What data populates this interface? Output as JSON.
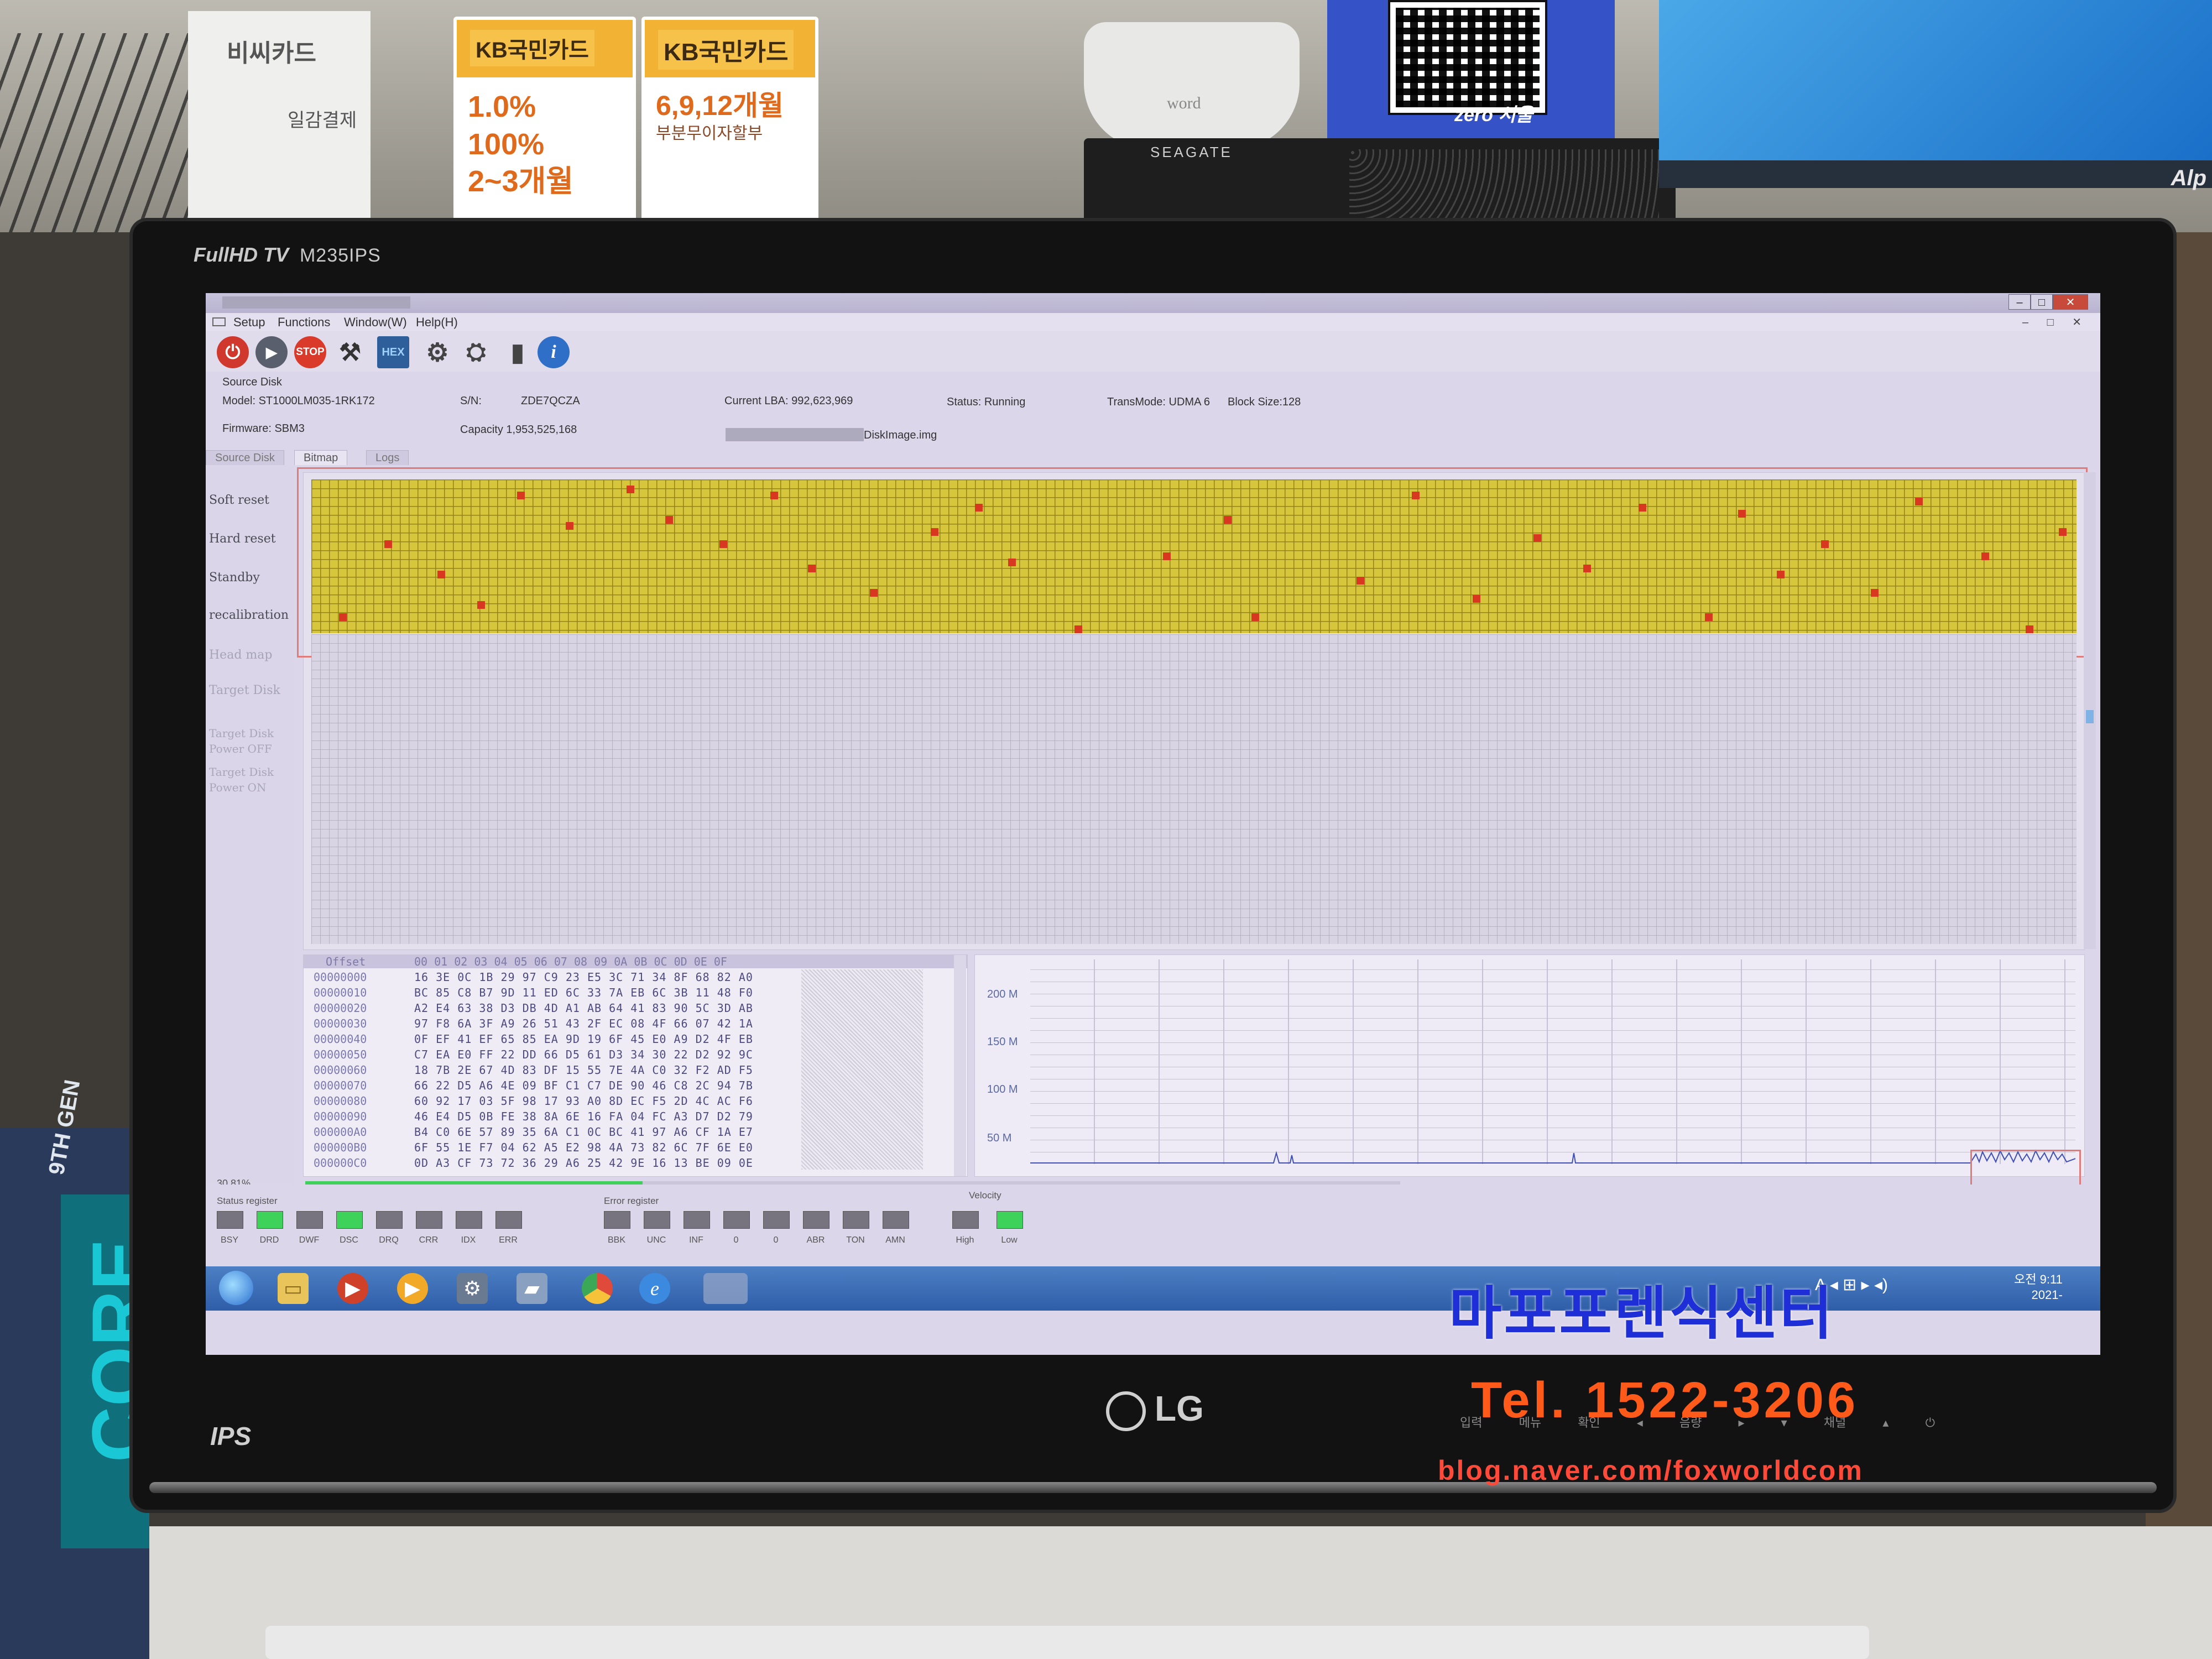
{
  "environment": {
    "card_signs": [
      {
        "title": "KB국민카드",
        "line1": "1.0%",
        "line2": "100%",
        "line3": "2~3개월"
      },
      {
        "title": "KB국민카드",
        "line1": "6,9,12개월",
        "line2": "부분무이자할부"
      }
    ],
    "white_sign": {
      "title": "비씨카드",
      "line": "일감결제"
    },
    "qr_caption": "zero 서울",
    "speaker_brand": "SEAGATE",
    "lamp_brand": "word",
    "other_monitor_brand": "Alp",
    "box_label_top": "9TH GEN",
    "box_label_main": "CORE"
  },
  "monitor": {
    "brand_left": "FullHD TV",
    "model": "M235IPS",
    "brand_logo": "LG",
    "panel_logo": "IPS",
    "buttons_label": "입력 메뉴 확인 ◂ 음량 ▸ ▾ 채널 ▴ ⏻"
  },
  "app": {
    "window_buttons": {
      "minimize": "–",
      "maximize": "□",
      "close": "✕"
    },
    "mdi_buttons": "– □ ✕",
    "menu": [
      "Setup",
      "Functions",
      "Window(W)",
      "Help(H)"
    ],
    "toolbar": {
      "power": "⏻",
      "play": "▶",
      "stop": "STOP",
      "tools": "⚒",
      "hex": "HEX",
      "gear": "⚙",
      "disk": "⛭",
      "book": "▮",
      "info": "i"
    },
    "source_disk": {
      "section_label": "Source Disk",
      "model": "Model: ST1000LM035-1RK172",
      "sn_label": "S/N:",
      "sn_value": "ZDE7QCZA",
      "current_lba": "Current LBA:  992,623,969",
      "status": "Status: Running",
      "transmode": "TransMode: UDMA 6",
      "block_size": "Block Size:128",
      "firmware": "Firmware: SBM3",
      "capacity": "Capacity   1,953,525,168",
      "image_file": "DiskImage.img"
    },
    "tabs": [
      "Source Disk",
      "Bitmap",
      "Logs"
    ],
    "active_tab": "Bitmap",
    "side_panel": [
      "Soft reset",
      "Hard reset",
      "Standby",
      "recalibration",
      "Head map",
      "Target Disk",
      "Target Disk Power OFF",
      "Target Disk Power ON"
    ],
    "hex": {
      "offset_label": "Offset",
      "header": "00 01 02 03 04 05 06 07 08 09 0A 0B 0C 0D 0E 0F",
      "rows": [
        {
          "offset": "00000000",
          "bytes": "16 3E 0C 1B 29 97 C9 23 E5 3C 71 34 8F 68 82 A0"
        },
        {
          "offset": "00000010",
          "bytes": "BC 85 C8 B7 9D 11 ED 6C 33 7A EB 6C 3B 11 48 F0"
        },
        {
          "offset": "00000020",
          "bytes": "A2 E4 63 38 D3 DB 4D A1 AB 64 41 83 90 5C 3D AB"
        },
        {
          "offset": "00000030",
          "bytes": "97 F8 6A 3F A9 26 51 43 2F EC 08 4F 66 07 42 1A"
        },
        {
          "offset": "00000040",
          "bytes": "0F EF 41 EF 65 85 EA 9D 19 6F 45 E0 A9 D2 4F EB"
        },
        {
          "offset": "00000050",
          "bytes": "C7 EA E0 FF 22 DD 66 D5 61 D3 34 30 22 D2 92 9C"
        },
        {
          "offset": "00000060",
          "bytes": "18 7B 2E 67 4D 83 DF 15 55 7E 4A C0 32 F2 AD F5"
        },
        {
          "offset": "00000070",
          "bytes": "66 22 D5 A6 4E 09 BF C1 C7 DE 90 46 C8 2C 94 7B"
        },
        {
          "offset": "00000080",
          "bytes": "60 92 17 03 5F 98 17 93 A0 8D EC F5 2D 4C AC F6"
        },
        {
          "offset": "00000090",
          "bytes": "46 E4 D5 0B FE 38 8A 6E 16 FA 04 FC A3 D7 D2 79"
        },
        {
          "offset": "000000A0",
          "bytes": "B4 C0 6E 57 89 35 6A C1 0C BC 41 97 A6 CF 1A E7"
        },
        {
          "offset": "000000B0",
          "bytes": "6F 55 1E F7 04 62 A5 E2 98 4A 73 82 6C 7F 6E E0"
        },
        {
          "offset": "000000C0",
          "bytes": "0D A3 CF 73 72 36 29 A6 25 42 9E 16 13 BE 09 0E"
        }
      ]
    },
    "speed_axis": [
      "200 M",
      "150 M",
      "100 M",
      "50 M"
    ],
    "progress": {
      "text": "30.81%",
      "fraction": 0.3081
    },
    "status_register": {
      "title": "Status register",
      "items": [
        {
          "label": "BSY",
          "on": false
        },
        {
          "label": "DRD",
          "on": true
        },
        {
          "label": "DWF",
          "on": false
        },
        {
          "label": "DSC",
          "on": true
        },
        {
          "label": "DRQ",
          "on": false
        },
        {
          "label": "CRR",
          "on": false
        },
        {
          "label": "IDX",
          "on": false
        },
        {
          "label": "ERR",
          "on": false
        }
      ]
    },
    "error_register": {
      "title": "Error register",
      "items": [
        {
          "label": "BBK",
          "on": false
        },
        {
          "label": "UNC",
          "on": false
        },
        {
          "label": "INF",
          "on": false
        },
        {
          "label": "0",
          "on": false
        },
        {
          "label": "0",
          "on": false
        },
        {
          "label": "ABR",
          "on": false
        },
        {
          "label": "TON",
          "on": false
        },
        {
          "label": "AMN",
          "on": false
        }
      ]
    },
    "velocity": {
      "title": "Velocity",
      "items": [
        {
          "label": "High",
          "on": false
        },
        {
          "label": "Low",
          "on": true
        }
      ]
    },
    "taskbar": {
      "tray": "A ◂ ⊞ ▸ ◂)",
      "time": "오전 9:11",
      "date": "2021-"
    }
  },
  "watermark": {
    "name": "마포포렌식센터",
    "tel": "Tel. 1522-3206",
    "blog": "blog.naver.com/foxworldcom"
  },
  "colors": {
    "bitmap_read": "#d7c53b",
    "bad_sector": "#d8381f",
    "led_on": "#3fd25a",
    "highlight_frame": "#e07b7b",
    "watermark_blue": "#1f2fd8",
    "watermark_orange": "#ff5a1a"
  }
}
